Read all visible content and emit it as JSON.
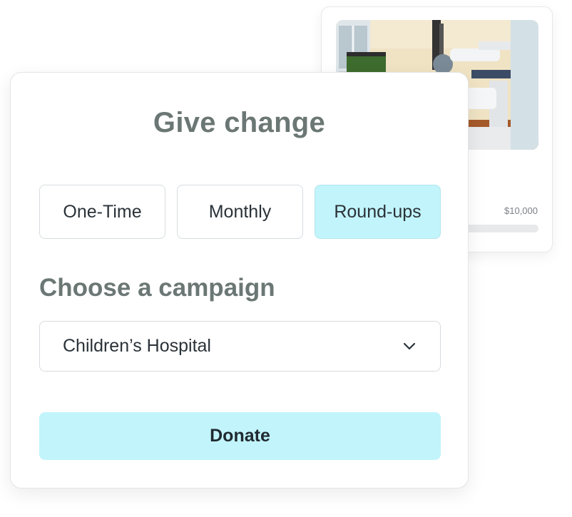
{
  "campaign_card": {
    "goal_amount": "$10,000",
    "progress_fraction": 0.0
  },
  "give_card": {
    "title": "Give change",
    "frequency_options": [
      {
        "label": "One-Time",
        "selected": false
      },
      {
        "label": "Monthly",
        "selected": false
      },
      {
        "label": "Round-ups",
        "selected": true
      }
    ],
    "campaign_heading": "Choose a campaign",
    "campaign_select": {
      "value": "Children’s Hospital",
      "icon": "chevron-down-icon"
    },
    "donate_label": "Donate"
  },
  "colors": {
    "accent": "#c2f4fb",
    "heading": "#6b7774",
    "text": "#2a3238"
  }
}
